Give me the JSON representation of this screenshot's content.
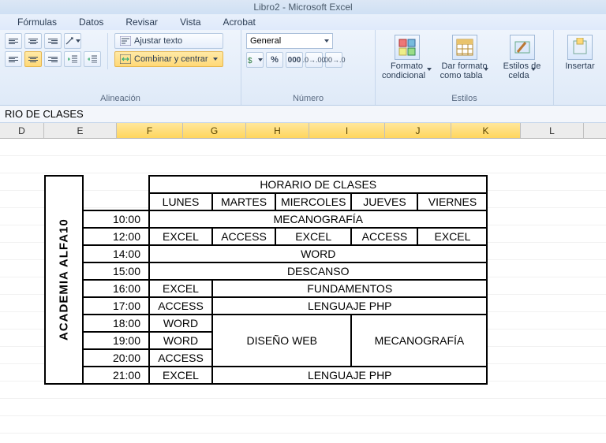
{
  "window": {
    "title": "Libro2 - Microsoft Excel"
  },
  "menu": {
    "formulas": "Fórmulas",
    "datos": "Datos",
    "revisar": "Revisar",
    "vista": "Vista",
    "acrobat": "Acrobat"
  },
  "ribbon": {
    "alignment": {
      "wrap": "Ajustar texto",
      "merge": "Combinar y centrar",
      "group": "Alineación"
    },
    "number": {
      "format": "General",
      "group": "Número"
    },
    "styles": {
      "cond": "Formato condicional",
      "table": "Dar formato como tabla",
      "cell": "Estilos de celda",
      "group": "Estilos"
    },
    "cells": {
      "insert": "Insertar"
    }
  },
  "formula_bar": {
    "text": "RIO DE CLASES"
  },
  "columns": [
    "D",
    "E",
    "F",
    "G",
    "H",
    "I",
    "J",
    "K",
    "L"
  ],
  "selected_cols": [
    "F",
    "G",
    "H",
    "I",
    "J",
    "K"
  ],
  "schedule": {
    "side_label": "ACADEMIA ALFA10",
    "title": "HORARIO DE CLASES",
    "days": [
      "LUNES",
      "MARTES",
      "MIERCOLES",
      "JUEVES",
      "VIERNES"
    ],
    "times": [
      "10:00",
      "12:00",
      "14:00",
      "15:00",
      "16:00",
      "17:00",
      "18:00",
      "19:00",
      "20:00",
      "21:00"
    ],
    "rows": {
      "r10": {
        "span5": "MECANOGRAFÍA"
      },
      "r12": {
        "c": [
          "EXCEL",
          "ACCESS",
          "EXCEL",
          "ACCESS",
          "EXCEL"
        ]
      },
      "r14": {
        "span5": "WORD"
      },
      "r15": {
        "span5": "DESCANSO"
      },
      "r16": {
        "first": "EXCEL",
        "rest": "FUNDAMENTOS"
      },
      "r17": {
        "first": "ACCESS",
        "rest": "LENGUAJE PHP"
      },
      "r18": {
        "first": "WORD"
      },
      "r19": {
        "first": "WORD",
        "block_a": "DISEÑO WEB",
        "block_b": "MECANOGRAFÍA"
      },
      "r20": {
        "first": "ACCESS"
      },
      "r21": {
        "first": "EXCEL",
        "rest": "LENGUAJE PHP"
      }
    }
  }
}
